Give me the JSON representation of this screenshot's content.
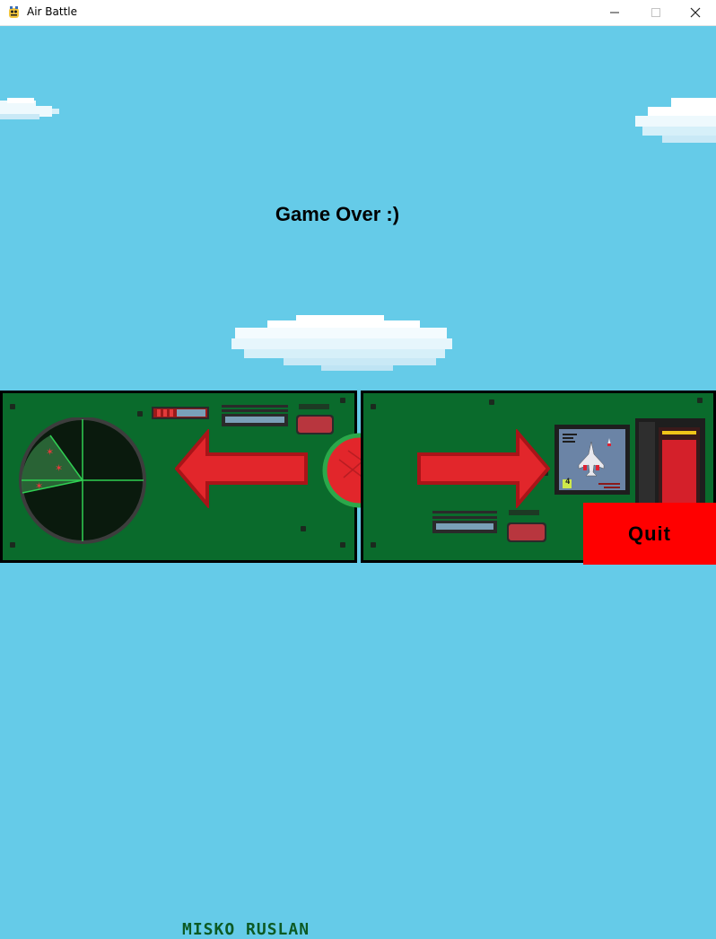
{
  "window": {
    "title": "Air Battle",
    "controls": [
      "minimize",
      "maximize",
      "close"
    ]
  },
  "game": {
    "status_text": "Game Over :)",
    "cockpit": {
      "maker_label": "MISKO RUSLAN",
      "screen_counter": "4",
      "radar_blips": 3
    },
    "quit_label": "Quit"
  },
  "colors": {
    "sky": "#65cbe8",
    "panel_green": "#0a6b2c",
    "arrow_red": "#e2262b",
    "quit_red": "#ff0000"
  }
}
